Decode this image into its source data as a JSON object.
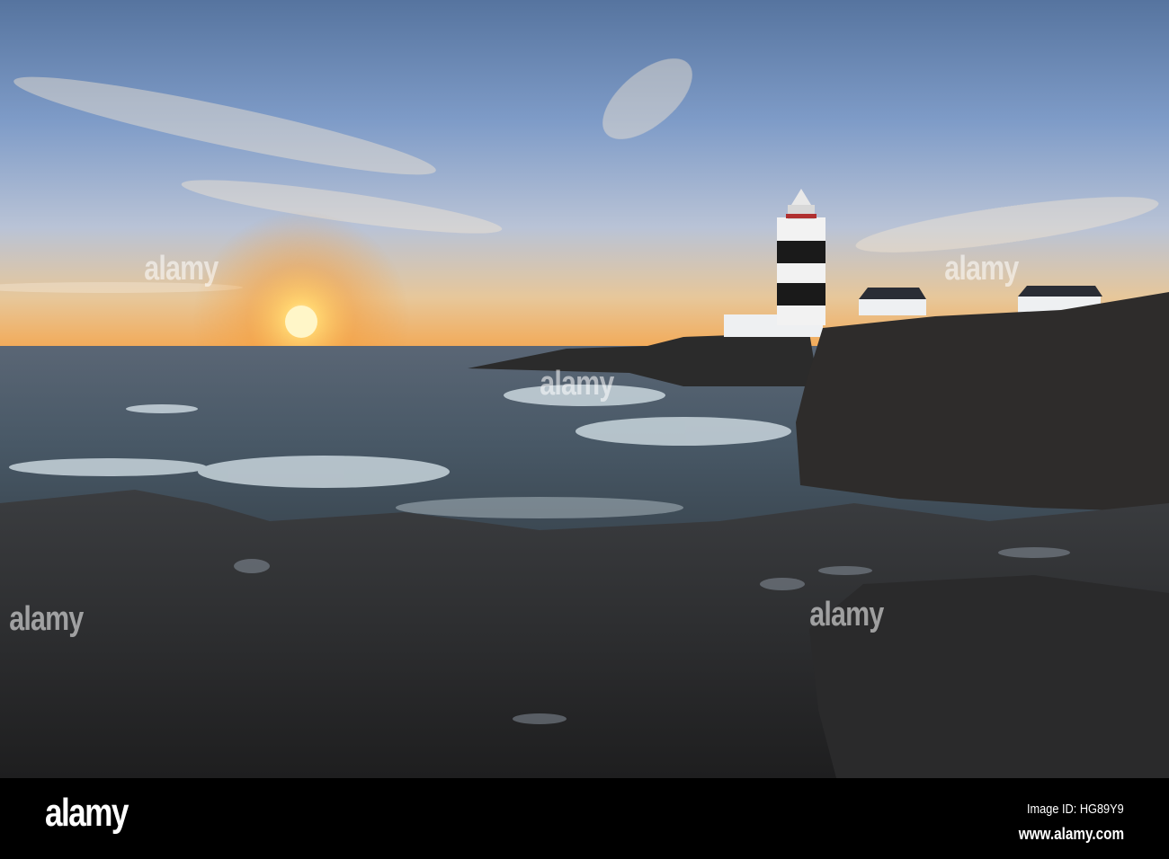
{
  "watermark": {
    "logo": "alamy",
    "image_id": "Image ID: HG89Y9",
    "website": "www.alamy.com"
  },
  "colors": {
    "sky_top": "#5e7fb8",
    "sky_horizon": "#f5b868",
    "sun": "#ffe9a0",
    "sea": "#3d4a5a",
    "rock": "#262626",
    "bar": "#000000"
  }
}
